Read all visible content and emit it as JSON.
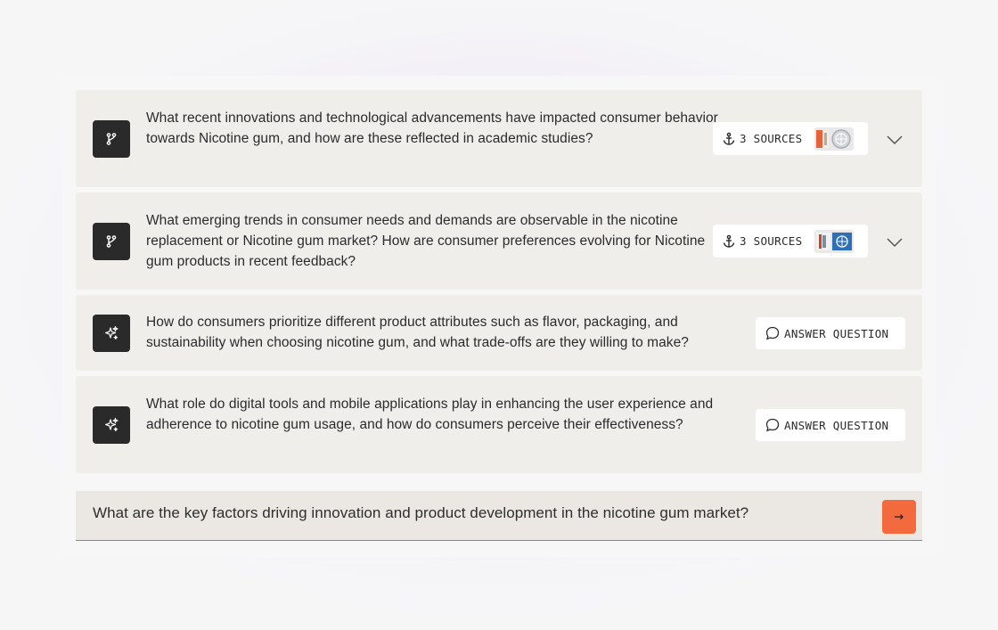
{
  "questions": [
    {
      "text": "What recent innovations and technological advancements have impacted consumer behavior towards Nicotine gum, and how are these reflected in academic studies?",
      "icon": "branch-icon",
      "sources_label": "3 SOURCES",
      "expanded": false
    },
    {
      "text": "What emerging trends in consumer needs and demands are observable in the nicotine replacement or Nicotine gum market? How are consumer preferences evolving for Nicotine gum products in recent feedback?",
      "icon": "branch-icon",
      "sources_label": "3 SOURCES",
      "expanded": false
    },
    {
      "text": "How do consumers prioritize different product attributes such as flavor, packaging, and sustainability when choosing nicotine gum, and what trade-offs are they willing to make?",
      "icon": "sparkle-icon",
      "action_label": "ANSWER QUESTION"
    },
    {
      "text": "What role do digital tools and mobile applications play in enhancing the user experience and adherence to nicotine gum usage, and how do consumers perceive their effectiveness?",
      "icon": "sparkle-icon",
      "action_label": "ANSWER QUESTION"
    }
  ],
  "input": {
    "value": "What are the key factors driving innovation and product development in the nicotine gum market?",
    "send_icon": "arrow-right-icon"
  },
  "colors": {
    "accent": "#f26a3d",
    "icon_bg": "#2a2a2a",
    "card_bg": "#efeeeb"
  }
}
